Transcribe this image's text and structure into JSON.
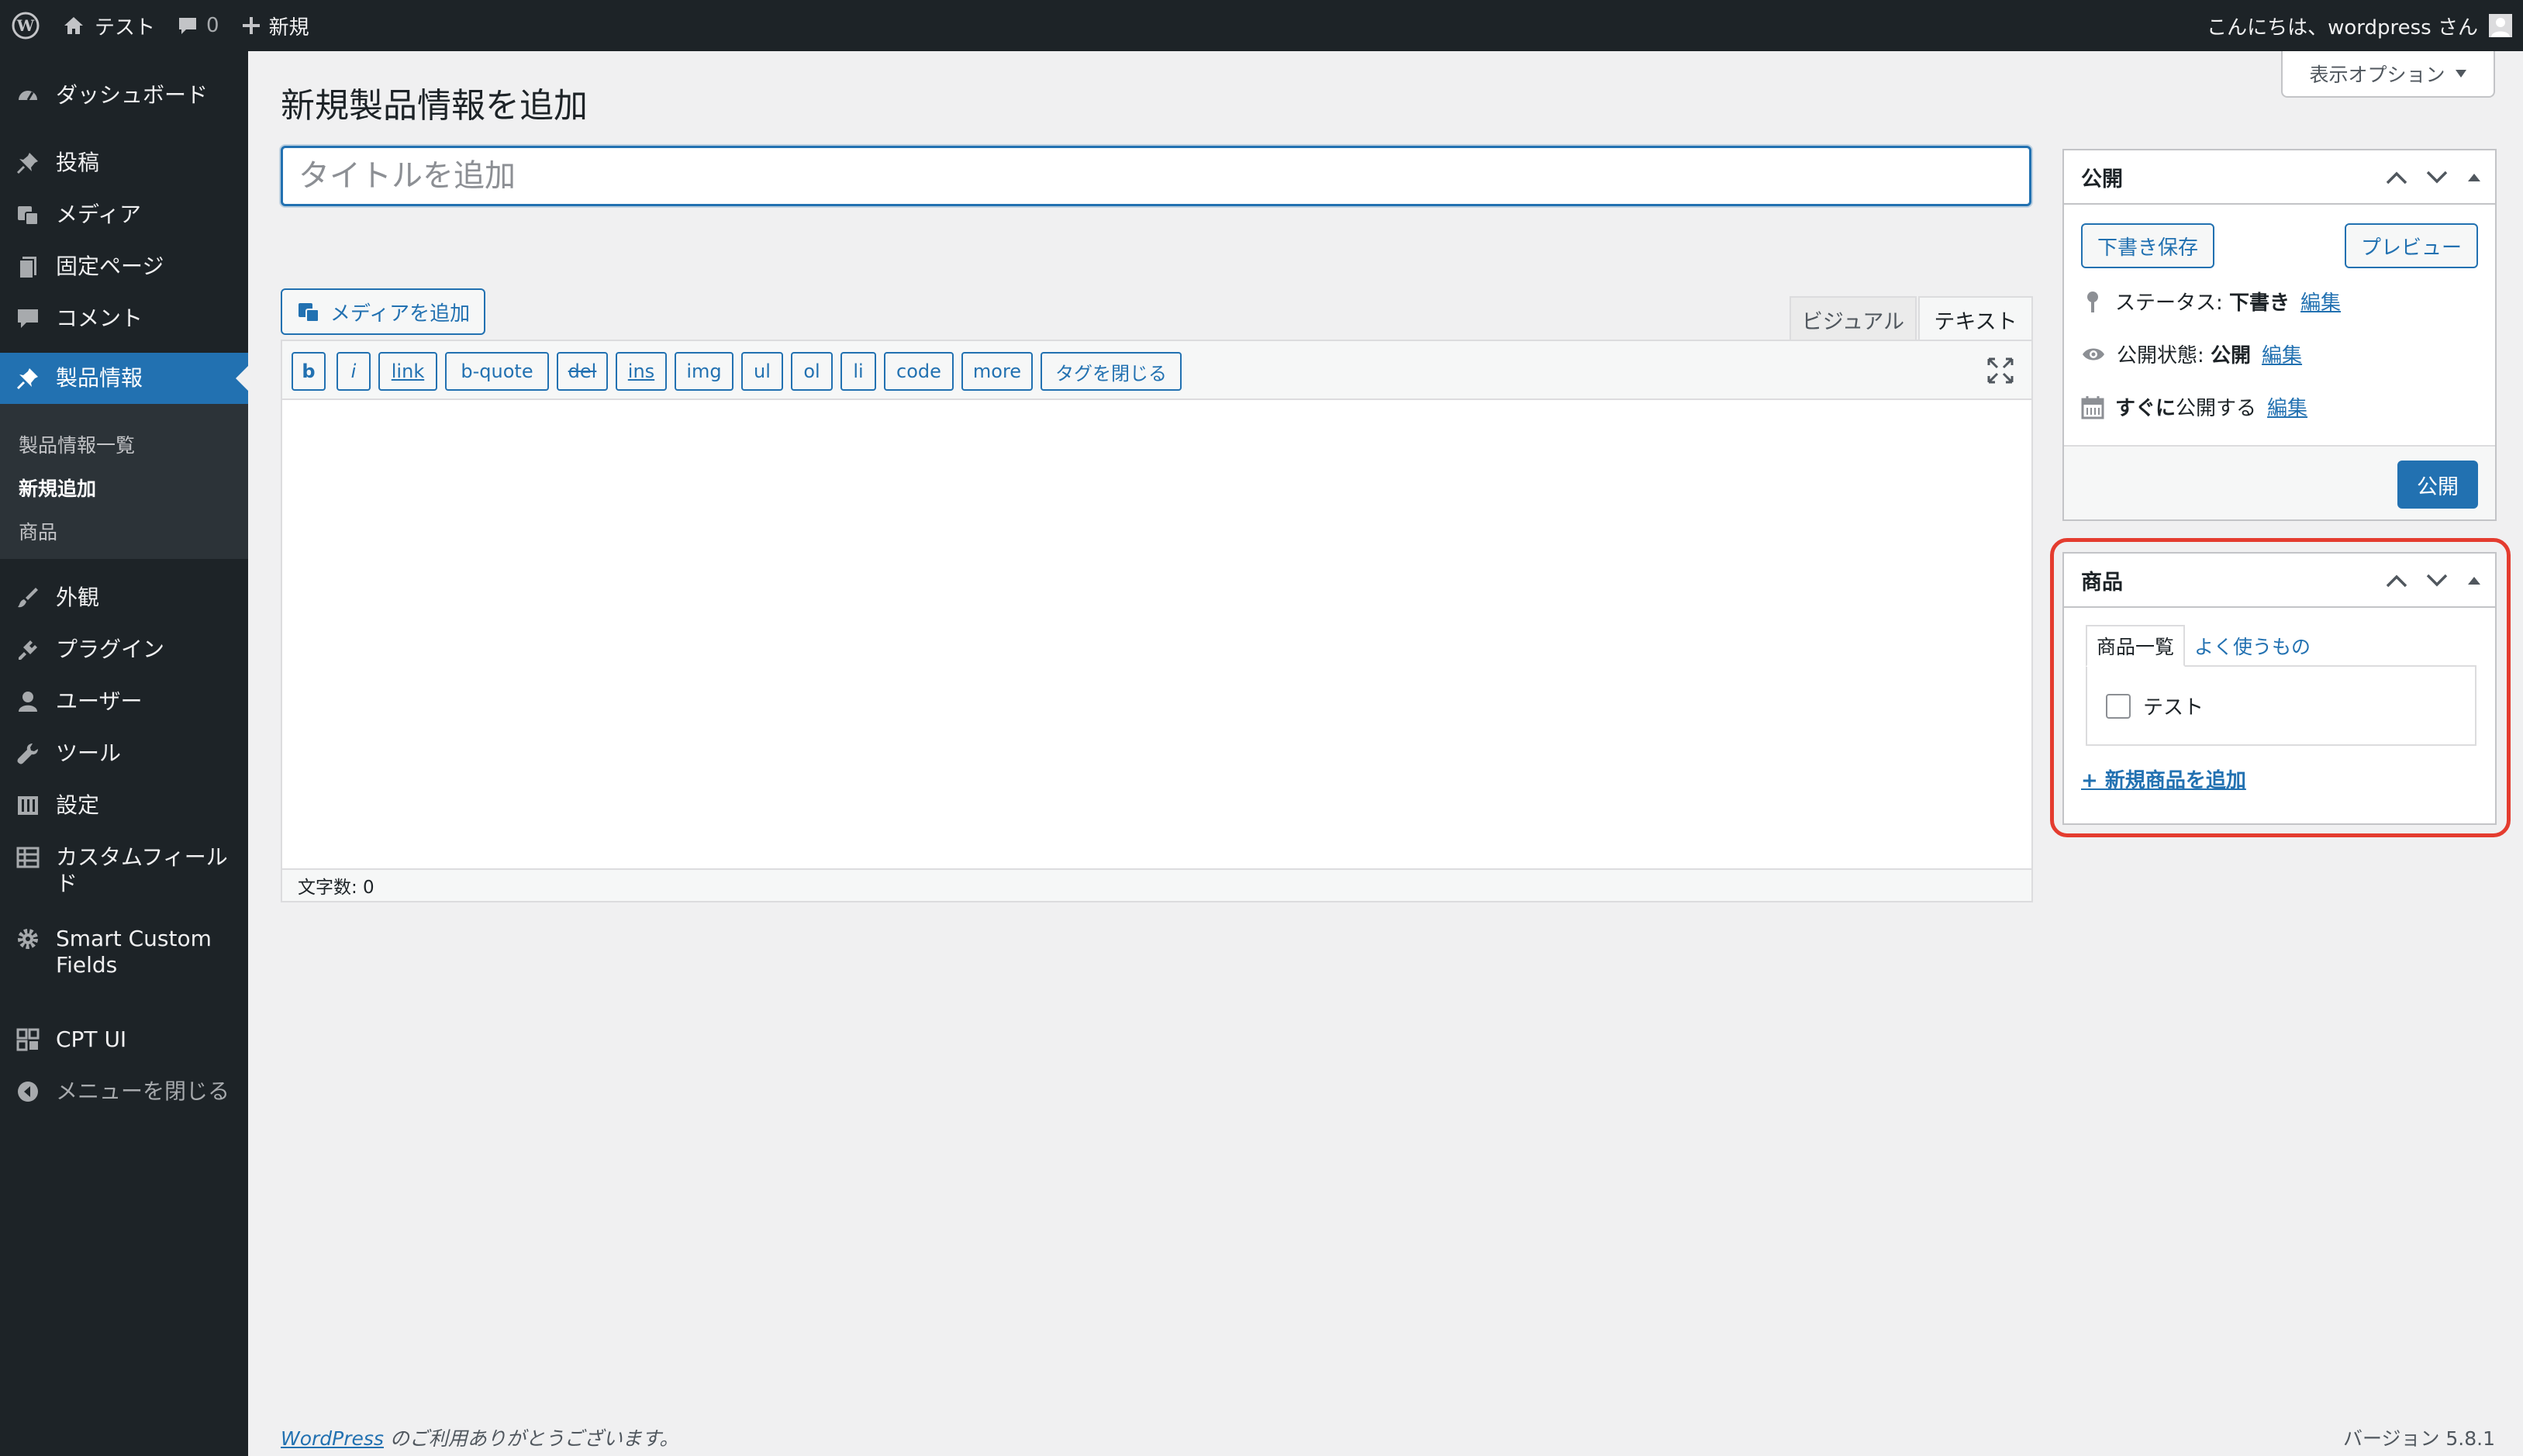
{
  "adminbar": {
    "site_name": "テスト",
    "comments_count": "0",
    "new_label": "新規",
    "greeting": "こんにちは、wordpress さん"
  },
  "sidebar": {
    "items": [
      {
        "label": "ダッシュボード",
        "icon": "dashboard-icon"
      },
      {
        "label": "投稿",
        "icon": "pin-icon"
      },
      {
        "label": "メディア",
        "icon": "media-icon"
      },
      {
        "label": "固定ページ",
        "icon": "page-icon"
      },
      {
        "label": "コメント",
        "icon": "comment-icon"
      },
      {
        "label": "製品情報",
        "icon": "pin-icon"
      },
      {
        "label": "外観",
        "icon": "brush-icon"
      },
      {
        "label": "プラグイン",
        "icon": "plugin-icon"
      },
      {
        "label": "ユーザー",
        "icon": "user-icon"
      },
      {
        "label": "ツール",
        "icon": "wrench-icon"
      },
      {
        "label": "設定",
        "icon": "settings-icon"
      },
      {
        "label": "カスタムフィールド",
        "icon": "table-icon"
      },
      {
        "label": "Smart Custom Fields",
        "icon": "gear-icon"
      },
      {
        "label": "CPT UI",
        "icon": "grid-icon"
      },
      {
        "label": "メニューを閉じる",
        "icon": "collapse-icon"
      }
    ],
    "submenu": [
      "製品情報一覧",
      "新規追加",
      "商品"
    ]
  },
  "main": {
    "screen_options": "表示オプション",
    "page_title": "新規製品情報を追加",
    "title_placeholder": "タイトルを追加",
    "add_media": "メディアを追加",
    "tab_visual": "ビジュアル",
    "tab_text": "テキスト",
    "quicktags": [
      "b",
      "i",
      "link",
      "b-quote",
      "del",
      "ins",
      "img",
      "ul",
      "ol",
      "li",
      "code",
      "more",
      "タグを閉じる"
    ],
    "word_count": "文字数: 0"
  },
  "publish": {
    "title": "公開",
    "save_draft": "下書き保存",
    "preview": "プレビュー",
    "status_label": "ステータス:",
    "status_value": "下書き",
    "visibility_label": "公開状態:",
    "visibility_value": "公開",
    "schedule_value": "すぐに",
    "schedule_rest": "公開する",
    "edit": "編集",
    "publish_button": "公開"
  },
  "taxonomy": {
    "title": "商品",
    "tab_all": "商品一覧",
    "tab_popular": "よく使うもの",
    "terms": [
      "テスト"
    ],
    "add_new": "+ 新規商品を追加"
  },
  "footer": {
    "wordpress_link": "WordPress",
    "thanks": " のご利用ありがとうございます。",
    "version": "バージョン 5.8.1"
  },
  "colors": {
    "accent": "#2271b1",
    "sidebar_bg": "#1d2327",
    "highlight": "#e43c2f"
  }
}
